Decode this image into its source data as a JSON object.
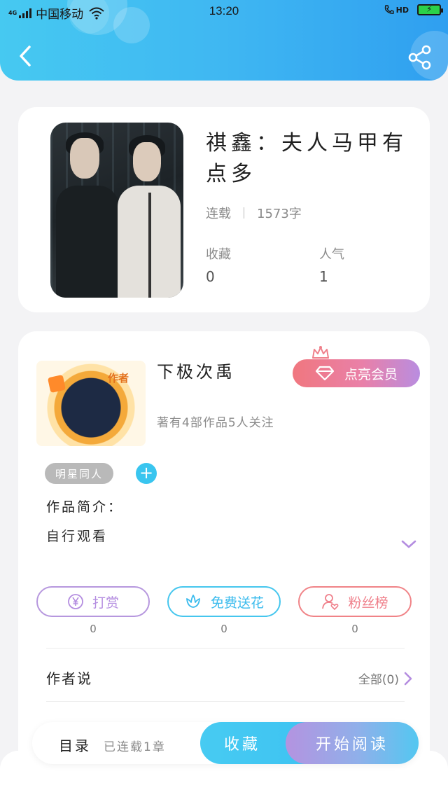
{
  "status_bar": {
    "network": "4G",
    "carrier": "中国移动",
    "time": "13:20",
    "hd_label": "HD",
    "battery_charging": true
  },
  "header": {
    "back_icon": "chevron-left-icon",
    "share_icon": "share-icon"
  },
  "book": {
    "title": "祺鑫：夫人马甲有点多",
    "status": "连载",
    "word_count": "1573字",
    "favorites_label": "收藏",
    "favorites_value": "0",
    "popularity_label": "人气",
    "popularity_value": "1"
  },
  "author": {
    "avatar_tag": "作者",
    "name": "下极次禹",
    "description": "著有4部作品5人关注",
    "vip_label": "点亮会员",
    "genre_tag": "明星同人",
    "intro_label": "作品简介：",
    "intro_text": "自行观看"
  },
  "actions": [
    {
      "label": "打赏",
      "icon": "yen-icon",
      "count": "0",
      "color": "#b48de0"
    },
    {
      "label": "免费送花",
      "icon": "flower-icon",
      "count": "0",
      "color": "#3abbed"
    },
    {
      "label": "粉丝榜",
      "icon": "user-heart-icon",
      "count": "0",
      "color": "#ef7f8a"
    }
  ],
  "author_says": {
    "label": "作者说",
    "all_link": "全部(0)"
  },
  "bottom_bar": {
    "toc_label": "目录",
    "chapters_text": "已连载1章",
    "collect_label": "收藏",
    "read_label": "开始阅读"
  },
  "colors": {
    "header_gradient_start": "#46c9f1",
    "header_gradient_end": "#2f9ff0",
    "accent_blue": "#3ec3f2",
    "vip_gradient_start": "#f0777f",
    "vip_gradient_end": "#b98de0"
  }
}
